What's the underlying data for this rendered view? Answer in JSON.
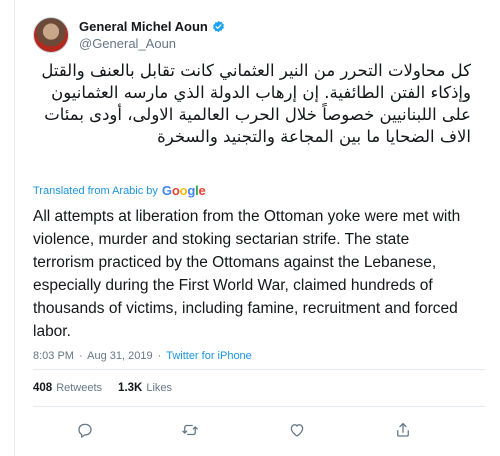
{
  "tweet": {
    "author": {
      "display_name": "General Michel Aoun",
      "handle": "@General_Aoun",
      "verified_icon": "verified-badge-icon",
      "verified_color": "#1da1f2"
    },
    "arabic_text": "كل محاولات التحرر من النير العثماني كانت تقابل بالعنف والقتل وإذكاء الفتن الطائفية. إن إرهاب الدولة الذي مارسه العثمانيون على اللبنانيين خصوصاً خلال الحرب العالمية الاولى، أودى بمئات الاف الضحايا ما بين المجاعة والتجنيد والسخرة",
    "translation_label": "Translated from Arabic by",
    "translation_provider": "Google",
    "translated_text": "All attempts at liberation from the Ottoman yoke were met with violence, murder and stoking sectarian strife. The state terrorism practiced by the Ottomans against the Lebanese, especially during the First World War, claimed hundreds of thousands of victims, including famine, recruitment and forced labor.",
    "time": "8:03 PM",
    "date": "Aug 31, 2019",
    "separator": "·",
    "source": "Twitter for iPhone",
    "stats": {
      "retweets_count": "408",
      "retweets_label": "Retweets",
      "likes_count": "1.3K",
      "likes_label": "Likes"
    },
    "actions": [
      {
        "icon": "reply-icon"
      },
      {
        "icon": "retweet-icon"
      },
      {
        "icon": "like-icon"
      },
      {
        "icon": "share-icon"
      }
    ],
    "colors": {
      "link": "#1b95e0",
      "muted": "#657786",
      "text": "#14171a",
      "divider": "#e6ecf0"
    }
  }
}
